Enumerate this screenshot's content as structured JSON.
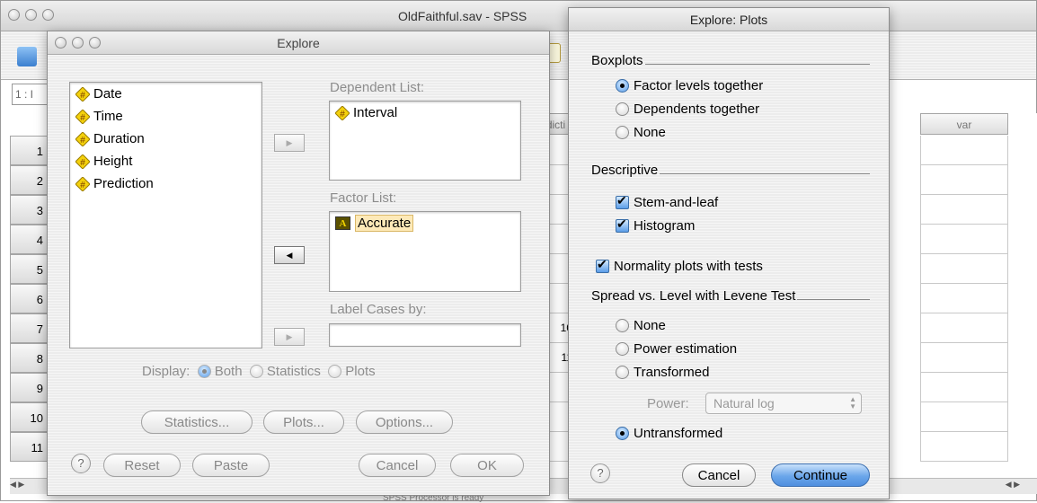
{
  "spss": {
    "title": "OldFaithful.sav - SPSS",
    "cell_ref": "1 : I",
    "columns": [
      "dicti",
      "var"
    ],
    "row_numbers": [
      "1",
      "2",
      "3",
      "4",
      "5",
      "6",
      "7",
      "8",
      "9",
      "10",
      "11"
    ],
    "partial_cells": [
      "10",
      "11"
    ],
    "status": "SPSS Processor is ready"
  },
  "explore": {
    "title": "Explore",
    "source_vars": [
      "Date",
      "Time",
      "Duration",
      "Height",
      "Prediction"
    ],
    "dependent_label": "Dependent List:",
    "dependent_items": [
      "Interval"
    ],
    "factor_label": "Factor List:",
    "factor_items": [
      "Accurate"
    ],
    "label_cases_label": "Label Cases by:",
    "display": {
      "label": "Display:",
      "options": [
        "Both",
        "Statistics",
        "Plots"
      ],
      "selected": "Both"
    },
    "buttons": {
      "statistics": "Statistics...",
      "plots": "Plots...",
      "options": "Options...",
      "reset": "Reset",
      "paste": "Paste",
      "cancel": "Cancel",
      "ok": "OK",
      "help": "?"
    }
  },
  "plots": {
    "title": "Explore: Plots",
    "boxplots": {
      "label": "Boxplots",
      "options": [
        "Factor levels together",
        "Dependents together",
        "None"
      ],
      "selected": "Factor levels together"
    },
    "descriptive": {
      "label": "Descriptive",
      "stem_and_leaf": "Stem-and-leaf",
      "histogram": "Histogram",
      "stem_checked": true,
      "histogram_checked": true
    },
    "normality_label": "Normality plots with tests",
    "normality_checked": true,
    "spread": {
      "label": "Spread vs. Level with Levene Test",
      "options": [
        "None",
        "Power estimation",
        "Transformed",
        "Untransformed"
      ],
      "selected": "Untransformed",
      "power_label": "Power:",
      "power_value": "Natural log"
    },
    "buttons": {
      "cancel": "Cancel",
      "continue": "Continue",
      "help": "?"
    }
  },
  "colors": {
    "default_button": "#5b9de8",
    "selection_highlight": "#fde9b8"
  }
}
